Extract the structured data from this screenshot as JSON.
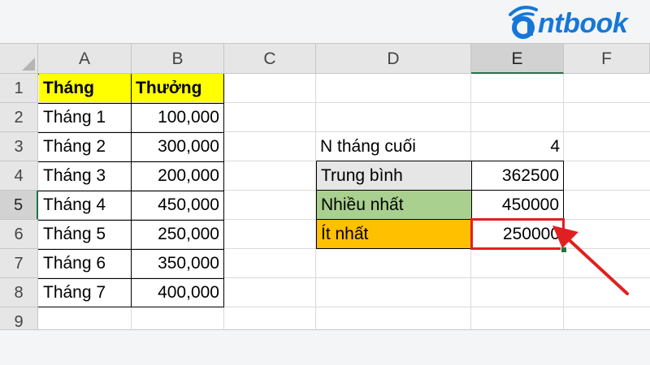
{
  "brand": {
    "name": "ntbook"
  },
  "colors": {
    "accent": "#1677d9",
    "header_yellow": "#ffff00",
    "avg_gray": "#e7e6e6",
    "max_green": "#a9d08e",
    "min_orange": "#ffc000",
    "highlight_red": "#e02020",
    "selection_green": "#217346"
  },
  "sheet": {
    "columns": [
      "A",
      "B",
      "C",
      "D",
      "E",
      "F"
    ],
    "rows": [
      "1",
      "2",
      "3",
      "4",
      "5",
      "6",
      "7",
      "8",
      "9"
    ],
    "selected_column": "E",
    "selected_row": "5",
    "table": {
      "header": {
        "month": "Tháng",
        "bonus": "Thưởng"
      },
      "entries": [
        {
          "month": "Tháng 1",
          "bonus": "100,000"
        },
        {
          "month": "Tháng 2",
          "bonus": "300,000"
        },
        {
          "month": "Tháng 3",
          "bonus": "200,000"
        },
        {
          "month": "Tháng 4",
          "bonus": "450,000"
        },
        {
          "month": "Tháng 5",
          "bonus": "250,000"
        },
        {
          "month": "Tháng 6",
          "bonus": "350,000"
        },
        {
          "month": "Tháng 7",
          "bonus": "400,000"
        }
      ]
    },
    "stats": {
      "n_label": "N tháng cuối",
      "n_value": "4",
      "avg_label": "Trung bình",
      "avg_value": "362500",
      "max_label": "Nhiều nhất",
      "max_value": "450000",
      "min_label": "Ít nhất",
      "min_value": "250000"
    }
  },
  "annotation": {
    "arrow_icon": "red-arrow-icon"
  }
}
